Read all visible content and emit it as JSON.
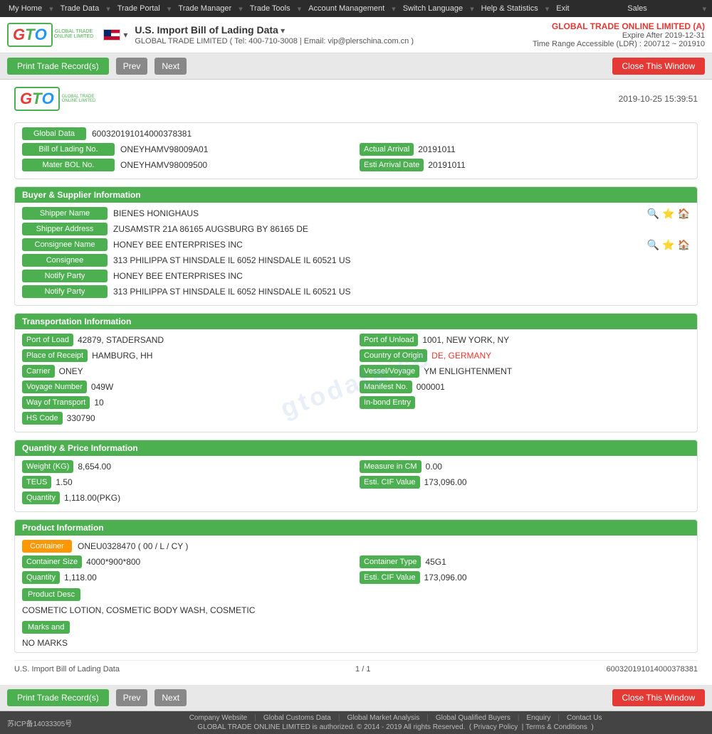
{
  "topnav": {
    "items": [
      "My Home",
      "Trade Data",
      "Trade Portal",
      "Trade Manager",
      "Trade Tools",
      "Account Management",
      "Switch Language",
      "Help & Statistics",
      "Exit"
    ],
    "sales": "Sales"
  },
  "header": {
    "title": "U.S. Import Bill of Lading Data",
    "contact": "GLOBAL TRADE LIMITED ( Tel: 400-710-3008 | Email: vip@plerschina.com.cn )",
    "company": "GLOBAL TRADE ONLINE LIMITED (A)",
    "expire": "Expire After 2019-12-31",
    "ldr": "Time Range Accessible (LDR) : 200712 ~ 201910"
  },
  "toolbar": {
    "print_label": "Print Trade Record(s)",
    "prev_label": "Prev",
    "next_label": "Next",
    "close_label": "Close This Window"
  },
  "doc": {
    "timestamp": "2019-10-25 15:39:51",
    "global_data_label": "Global Data",
    "global_data_value": "600320191014000378381",
    "bill_of_lading_label": "Bill of Lading No.",
    "bill_of_lading_value": "ONEYHAMV98009A01",
    "actual_arrival_label": "Actual Arrival",
    "actual_arrival_value": "20191011",
    "master_bol_label": "Mater BOL No.",
    "master_bol_value": "ONEYHAMV98009500",
    "esti_arrival_label": "Esti Arrival Date",
    "esti_arrival_value": "20191011"
  },
  "buyer_supplier": {
    "section_title": "Buyer & Supplier Information",
    "shipper_name_label": "Shipper Name",
    "shipper_name_value": "BIENES HONIGHAUS",
    "shipper_address_label": "Shipper Address",
    "shipper_address_value": "ZUSAMSTR 21A 86165 AUGSBURG BY 86165 DE",
    "consignee_name_label": "Consignee Name",
    "consignee_name_value": "HONEY BEE ENTERPRISES INC",
    "consignee_label": "Consignee",
    "consignee_value": "313 PHILIPPA ST HINSDALE IL 6052 HINSDALE IL 60521 US",
    "notify_party_label": "Notify Party",
    "notify_party_value1": "HONEY BEE ENTERPRISES INC",
    "notify_party_value2": "313 PHILIPPA ST HINSDALE IL 6052 HINSDALE IL 60521 US"
  },
  "transportation": {
    "section_title": "Transportation Information",
    "port_load_label": "Port of Load",
    "port_load_value": "42879, STADERSAND",
    "port_unload_label": "Port of Unload",
    "port_unload_value": "1001, NEW YORK, NY",
    "place_receipt_label": "Place of Receipt",
    "place_receipt_value": "HAMBURG, HH",
    "country_origin_label": "Country of Origin",
    "country_origin_value": "DE, GERMANY",
    "carrier_label": "Carrier",
    "carrier_value": "ONEY",
    "vessel_label": "Vessel/Voyage",
    "vessel_value": "YM ENLIGHTENMENT",
    "voyage_label": "Voyage Number",
    "voyage_value": "049W",
    "manifest_label": "Manifest No.",
    "manifest_value": "000001",
    "way_transport_label": "Way of Transport",
    "way_transport_value": "10",
    "inbond_label": "In-bond Entry",
    "inbond_value": "",
    "hs_code_label": "HS Code",
    "hs_code_value": "330790"
  },
  "quantity_price": {
    "section_title": "Quantity & Price Information",
    "weight_label": "Weight (KG)",
    "weight_value": "8,654.00",
    "measure_label": "Measure in CM",
    "measure_value": "0.00",
    "teus_label": "TEUS",
    "teus_value": "1.50",
    "cif_label": "Esti. CIF Value",
    "cif_value": "173,096.00",
    "quantity_label": "Quantity",
    "quantity_value": "1,118.00(PKG)"
  },
  "product": {
    "section_title": "Product Information",
    "container_label": "Container",
    "container_value": "ONEU0328470 ( 00 / L / CY )",
    "container_size_label": "Container Size",
    "container_size_value": "4000*900*800",
    "container_type_label": "Container Type",
    "container_type_value": "45G1",
    "quantity_label": "Quantity",
    "quantity_value": "1,118.00",
    "esti_cif_label": "Esti. CIF Value",
    "esti_cif_value": "173,096.00",
    "product_desc_label": "Product Desc",
    "product_desc_value": "COSMETIC LOTION, COSMETIC BODY WASH, COSMETIC",
    "marks_label": "Marks and",
    "marks_value": "NO MARKS"
  },
  "doc_footer": {
    "left": "U.S. Import Bill of Lading Data",
    "center": "1 / 1",
    "right": "600320191014000378381"
  },
  "page_footer": {
    "links": [
      "Company Website",
      "Global Customs Data",
      "Global Market Analysis",
      "Global Qualified Buyers",
      "Enquiry",
      "Contact Us"
    ],
    "copyright": "GLOBAL TRADE ONLINE LIMITED is authorized. © 2014 - 2019 All rights Reserved.",
    "privacy": "Privacy Policy",
    "terms": "Terms & Conditions"
  },
  "bottom_bar": {
    "icp": "苏ICP备14033305号",
    "global_customs": "Global Customs Data"
  },
  "watermark": "gtodata.co"
}
